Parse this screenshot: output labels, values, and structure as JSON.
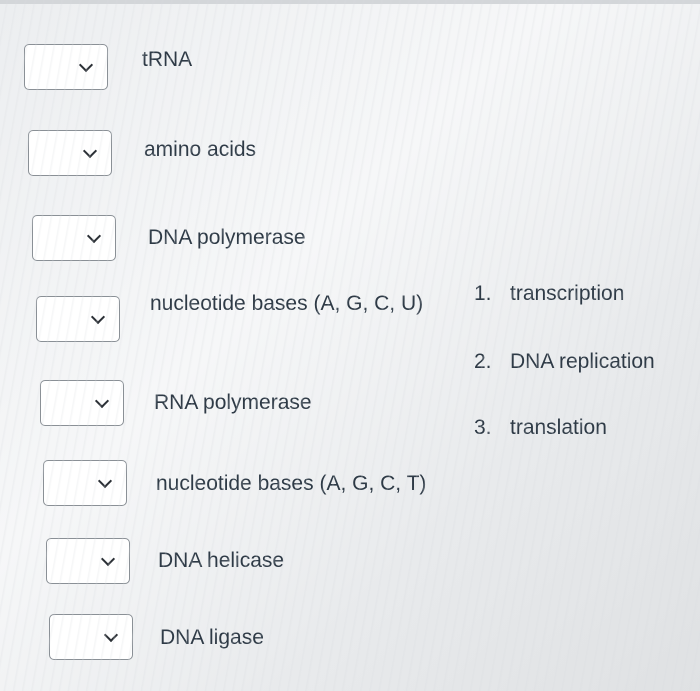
{
  "items": [
    {
      "label": "tRNA"
    },
    {
      "label": "amino acids"
    },
    {
      "label": "DNA polymerase"
    },
    {
      "label": "nucleotide bases (A, G, C, U)"
    },
    {
      "label": "RNA polymerase"
    },
    {
      "label": "nucleotide bases (A, G, C, T)"
    },
    {
      "label": "DNA helicase"
    },
    {
      "label": "DNA ligase"
    }
  ],
  "options": [
    {
      "number": "1.",
      "label": "transcription"
    },
    {
      "number": "2.",
      "label": "DNA replication"
    },
    {
      "number": "3.",
      "label": "translation"
    }
  ],
  "icons": {
    "dropdown": "chevron-down-icon"
  }
}
